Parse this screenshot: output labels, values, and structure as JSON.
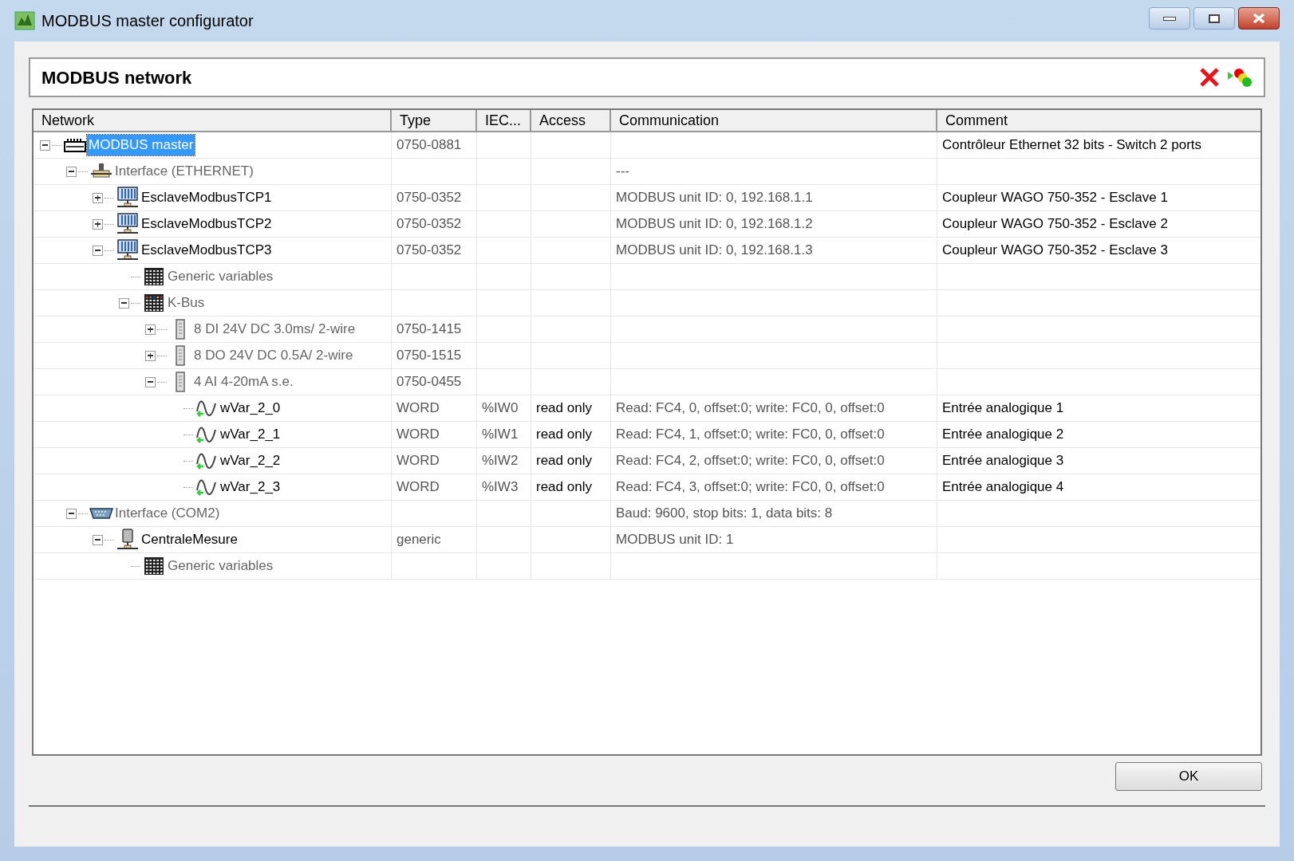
{
  "window": {
    "title": "MODBUS master configurator"
  },
  "panel": {
    "title": "MODBUS network"
  },
  "table": {
    "columns": [
      "Network",
      "Type",
      "IEC...",
      "Access",
      "Communication",
      "Comment"
    ],
    "rows": [
      {
        "name": "MODBUS master",
        "kind": "master",
        "expanded": true,
        "selected": true,
        "type": "0750-0881",
        "comment": "Contrôleur Ethernet 32 bits - Switch 2 ports",
        "children": [
          {
            "name": "Interface (ETHERNET)",
            "kind": "ethernet",
            "expanded": true,
            "selected": false,
            "communication": "---",
            "children": [
              {
                "name": "EsclaveModbusTCP1",
                "kind": "slave",
                "expanded": false,
                "selected": false,
                "type": "0750-0352",
                "communication": "MODBUS unit ID: 0, 192.168.1.1",
                "comment": "Coupleur WAGO 750-352 - Esclave 1"
              },
              {
                "name": "EsclaveModbusTCP2",
                "kind": "slave",
                "expanded": false,
                "selected": false,
                "type": "0750-0352",
                "communication": "MODBUS unit ID: 0, 192.168.1.2",
                "comment": "Coupleur WAGO 750-352 - Esclave 2"
              },
              {
                "name": "EsclaveModbusTCP3",
                "kind": "slave",
                "expanded": true,
                "selected": false,
                "type": "0750-0352",
                "communication": "MODBUS unit ID: 0, 192.168.1.3",
                "comment": "Coupleur WAGO 750-352 - Esclave 3",
                "children": [
                  {
                    "name": "Generic variables",
                    "kind": "generic",
                    "selected": false
                  },
                  {
                    "name": "K-Bus",
                    "kind": "kbus",
                    "expanded": true,
                    "selected": false,
                    "children": [
                      {
                        "name": "8 DI 24V DC 3.0ms/ 2-wire",
                        "kind": "module",
                        "expanded": false,
                        "selected": false,
                        "type": "0750-1415"
                      },
                      {
                        "name": "8 DO 24V DC 0.5A/ 2-wire",
                        "kind": "module",
                        "expanded": false,
                        "selected": false,
                        "type": "0750-1515"
                      },
                      {
                        "name": "4 AI 4-20mA s.e.",
                        "kind": "module",
                        "expanded": true,
                        "selected": false,
                        "type": "0750-0455",
                        "children": [
                          {
                            "name": "wVar_2_0",
                            "kind": "variable",
                            "selected": false,
                            "type": "WORD",
                            "iec": "%IW0",
                            "access": "read only",
                            "communication": "Read: FC4, 0, offset:0; write: FC0, 0, offset:0",
                            "comment": "Entrée analogique 1"
                          },
                          {
                            "name": "wVar_2_1",
                            "kind": "variable",
                            "selected": false,
                            "type": "WORD",
                            "iec": "%IW1",
                            "access": "read only",
                            "communication": "Read: FC4, 1, offset:0; write: FC0, 0, offset:0",
                            "comment": "Entrée analogique 2"
                          },
                          {
                            "name": "wVar_2_2",
                            "kind": "variable",
                            "selected": false,
                            "type": "WORD",
                            "iec": "%IW2",
                            "access": "read only",
                            "communication": "Read: FC4, 2, offset:0; write: FC0, 0, offset:0",
                            "comment": "Entrée analogique 3"
                          },
                          {
                            "name": "wVar_2_3",
                            "kind": "variable",
                            "selected": false,
                            "type": "WORD",
                            "iec": "%IW3",
                            "access": "read only",
                            "communication": "Read: FC4, 3, offset:0; write: FC0, 0, offset:0",
                            "comment": "Entrée analogique 4"
                          }
                        ]
                      }
                    ]
                  }
                ]
              }
            ]
          },
          {
            "name": "Interface (COM2)",
            "kind": "serial",
            "expanded": true,
            "selected": false,
            "communication": "Baud: 9600, stop bits: 1, data bits: 8",
            "children": [
              {
                "name": "CentraleMesure",
                "kind": "device",
                "expanded": true,
                "selected": false,
                "type": "generic",
                "communication": "MODBUS unit ID: 1",
                "children": [
                  {
                    "name": "Generic variables",
                    "kind": "generic",
                    "selected": false
                  }
                ]
              }
            ]
          }
        ]
      }
    ]
  },
  "footer": {
    "ok_button": "OK"
  }
}
